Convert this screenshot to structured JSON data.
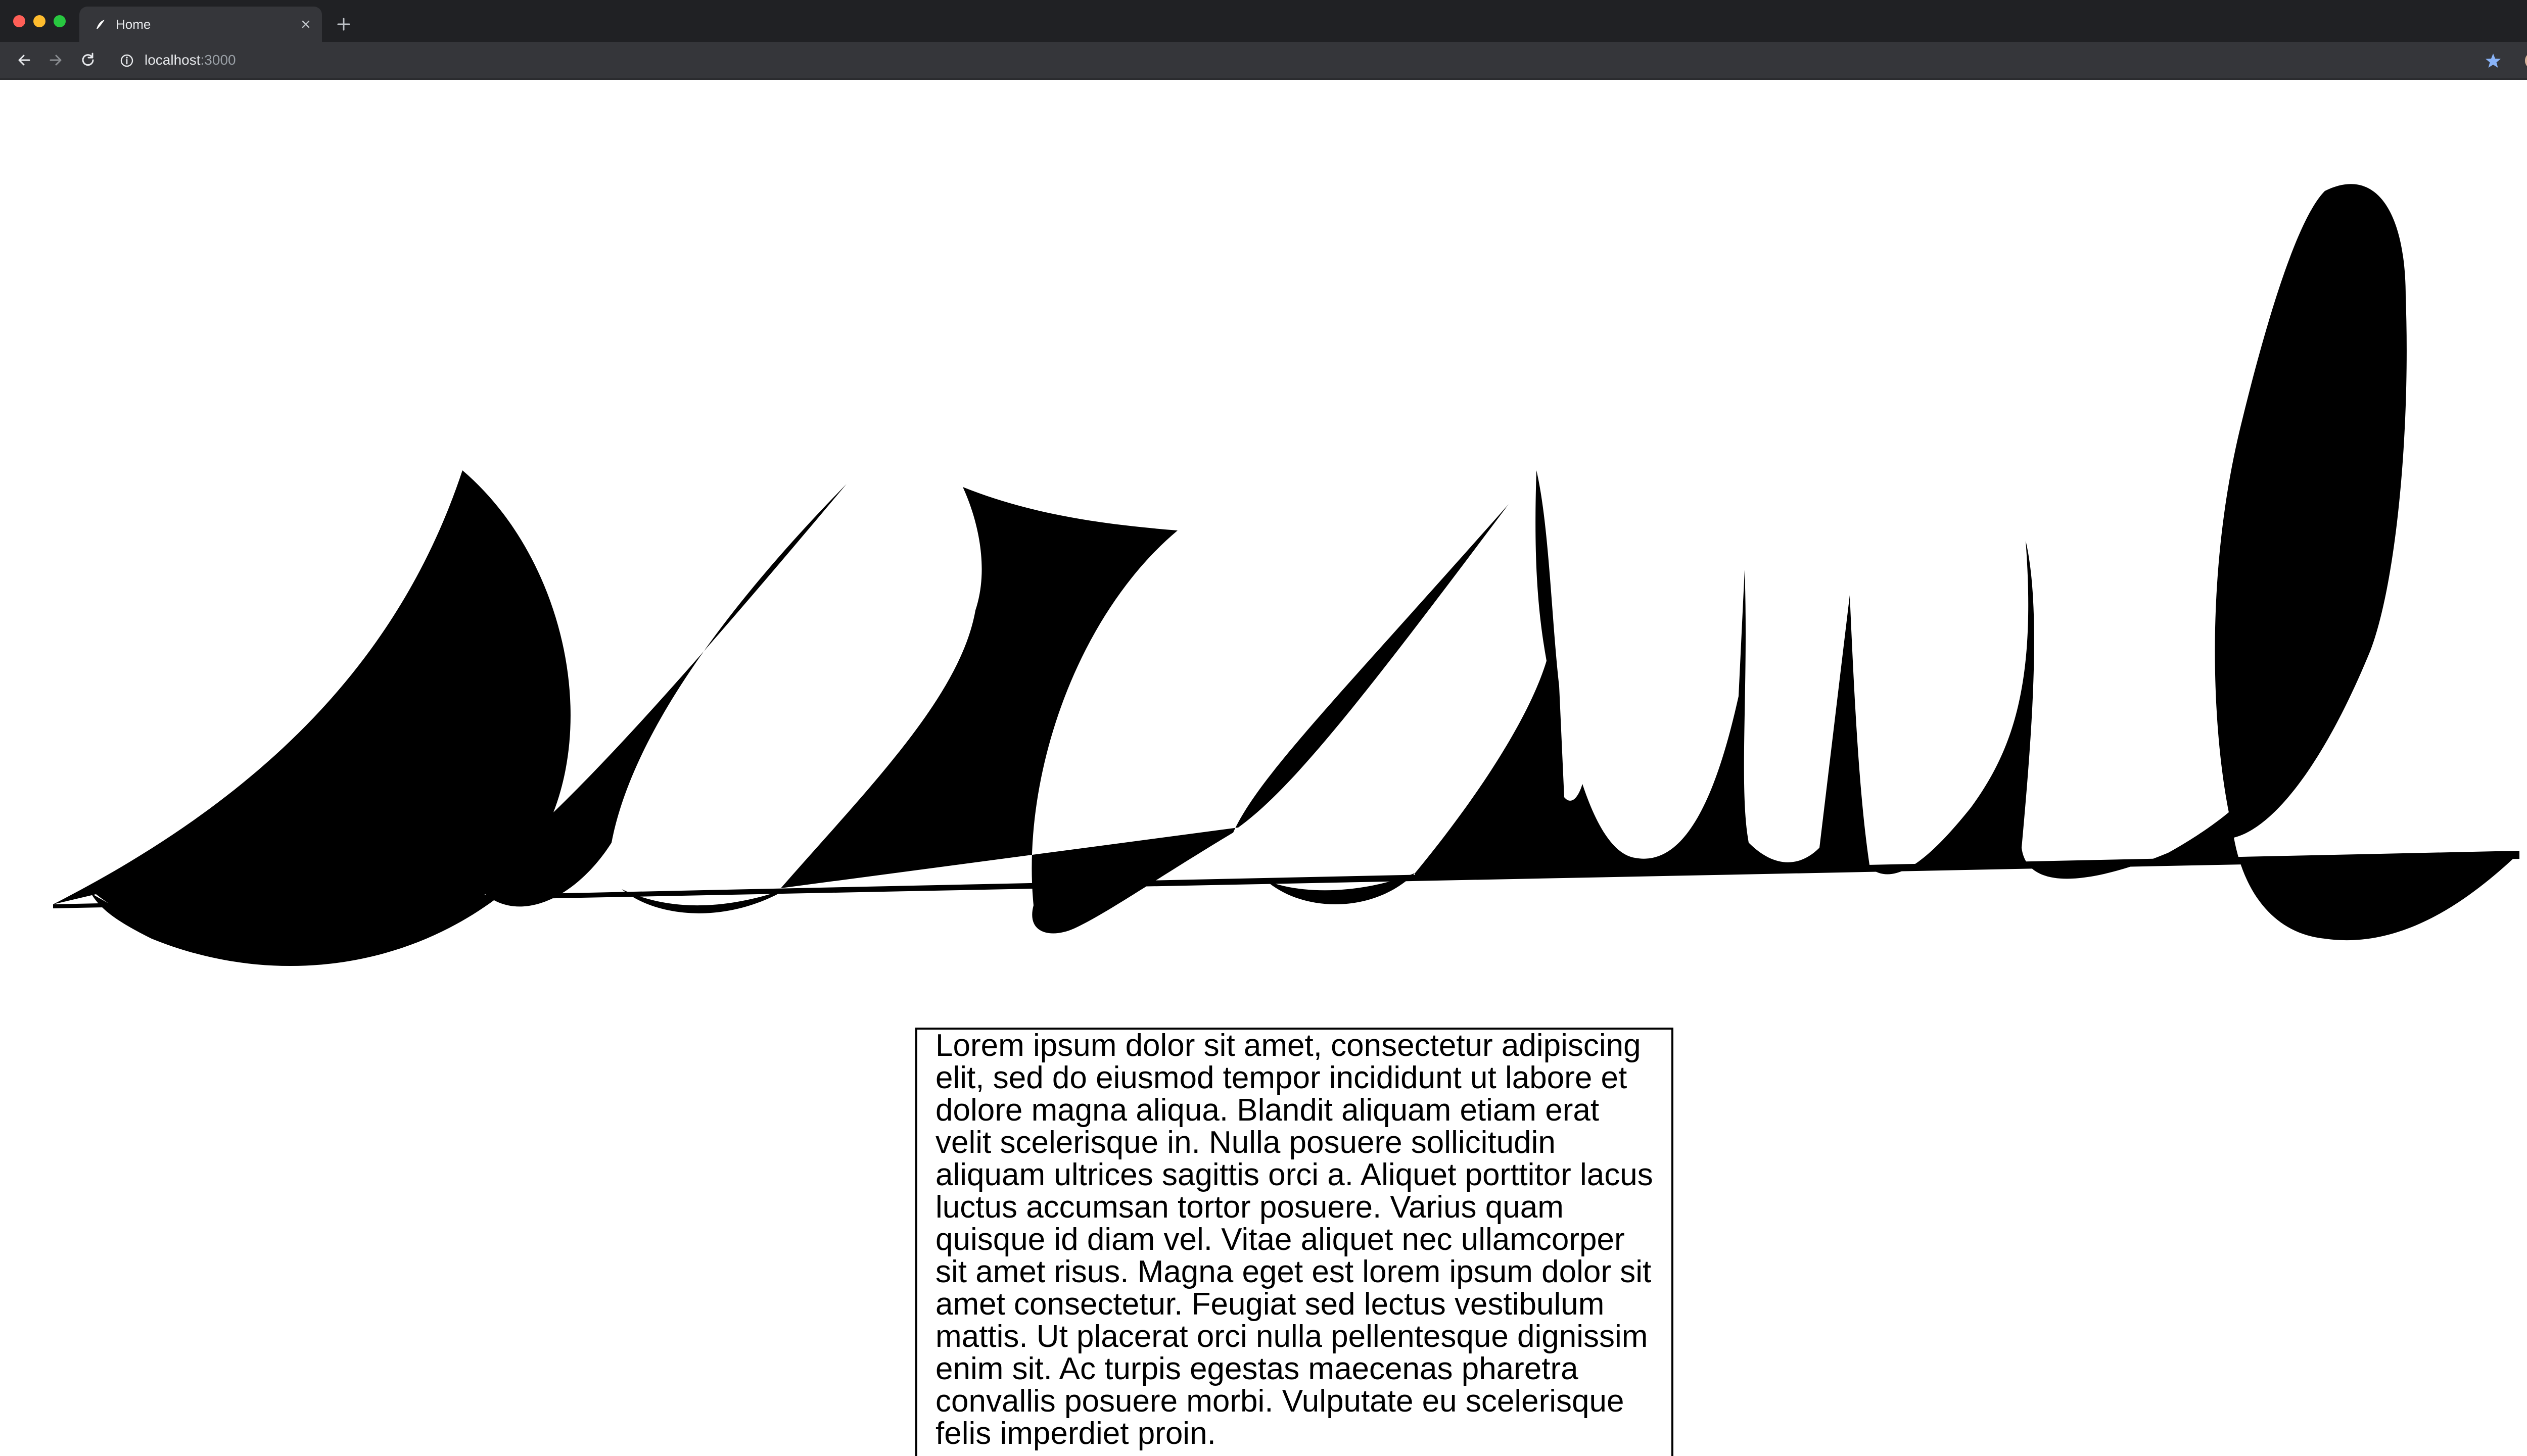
{
  "browser": {
    "tab_title": "Home",
    "url_host": "localhost",
    "url_port": ":3000",
    "icons": {
      "back": "arrow-left-icon",
      "forward": "arrow-right-icon",
      "reload": "reload-icon",
      "info": "info-icon",
      "star": "star-icon",
      "menu": "kebab-menu-icon",
      "close_tab": "close-icon",
      "new_tab": "plus-icon"
    },
    "colors": {
      "frame": "#202124",
      "toolbar": "#35363a",
      "bookmark_star": "#8ab4f8"
    }
  },
  "page": {
    "artwork": "wavy-black-shapes",
    "body_text": "Lorem ipsum dolor sit amet, consectetur adipiscing elit, sed do eiusmod tempor incididunt ut labore et dolore magna aliqua. Blandit aliquam etiam erat velit scelerisque in. Nulla posuere sollicitudin aliquam ultrices sagittis orci a. Aliquet porttitor lacus luctus accumsan tortor posuere. Varius quam quisque id diam vel. Vitae aliquet nec ullamcorper sit amet risus. Magna eget est lorem ipsum dolor sit amet consectetur. Feugiat sed lectus vestibulum mattis. Ut placerat orci nulla pellentesque dignissim enim sit. Ac turpis egestas maecenas pharetra convallis posuere morbi. Vulputate eu scelerisque felis imperdiet proin.",
    "corner_icon": "lightning-bolt-icon"
  }
}
